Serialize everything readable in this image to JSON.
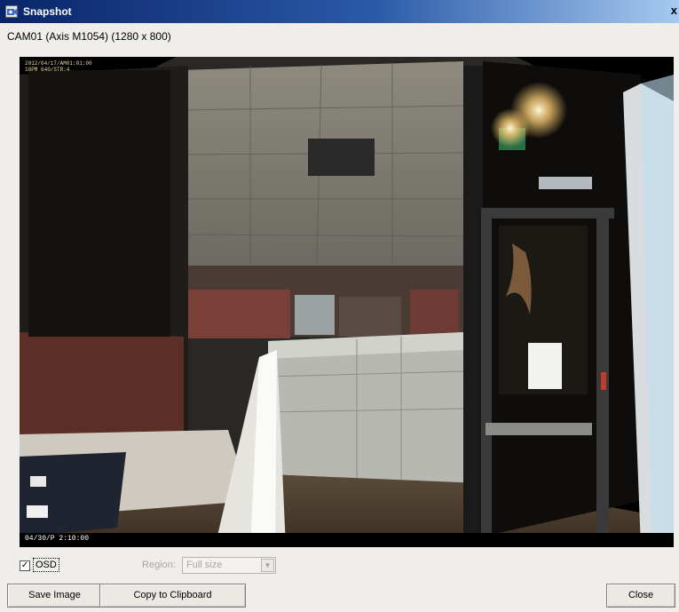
{
  "window": {
    "title": "Snapshot",
    "close_glyph": "x"
  },
  "camera_label": "CAM01 (Axis M1054) (1280 x 800)",
  "snapshot": {
    "overlay_top_line1": "2012/04/17/AM01:01:00",
    "overlay_top_line2": "10PM 640/STR:4",
    "overlay_bottom": "04/30/P 2:10:00"
  },
  "controls": {
    "osd_label": "OSD",
    "osd_checked": true,
    "check_glyph": "✓",
    "region_label": "Region:",
    "region_value": "Full size",
    "dropdown_glyph": "▼"
  },
  "buttons": {
    "save_image": "Save Image",
    "copy_clipboard": "Copy to Clipboard",
    "close": "Close"
  },
  "icons": {
    "window_icon": "camera-icon",
    "dropdown_icon": "chevron-down-icon"
  },
  "colors": {
    "titlebar_start": "#0a246a",
    "titlebar_end": "#a6caf0",
    "dialog_bg": "#f0eeea"
  }
}
